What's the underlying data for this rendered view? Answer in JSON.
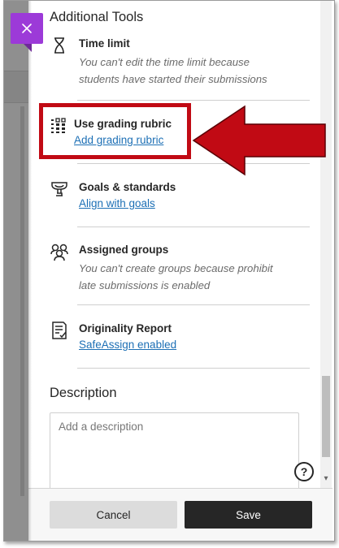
{
  "panel": {
    "section_title": "Additional Tools",
    "description_title": "Description"
  },
  "tools": [
    {
      "id": "time-limit",
      "icon": "hourglass-icon",
      "name": "Time limit",
      "subtitle": "You can't edit the time limit because students have started their submissions"
    },
    {
      "id": "grading-rubric",
      "icon": "rubric-icon",
      "name": "Use grading rubric",
      "link": "Add grading rubric"
    },
    {
      "id": "goals",
      "icon": "trophy-icon",
      "name": "Goals & standards",
      "link": "Align with goals"
    },
    {
      "id": "groups",
      "icon": "groups-icon",
      "name": "Assigned groups",
      "subtitle": "You can't create groups because prohibit late submissions is enabled"
    },
    {
      "id": "originality",
      "icon": "report-icon",
      "name": "Originality Report",
      "link": "SafeAssign enabled"
    }
  ],
  "description": {
    "placeholder": "Add a description"
  },
  "footer": {
    "cancel_label": "Cancel",
    "save_label": "Save"
  },
  "help_icon": "question-circle-icon",
  "colors": {
    "accent": "#9c3ad8",
    "link": "#1c6fb5",
    "highlight": "#c10a14",
    "save_bg": "#262626",
    "cancel_bg": "#dcdcdc"
  }
}
